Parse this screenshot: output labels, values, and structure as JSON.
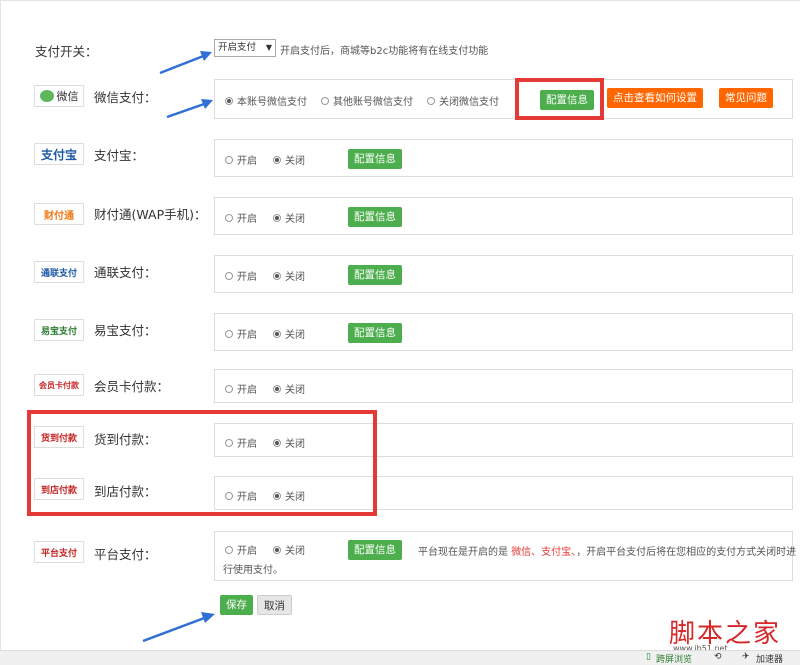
{
  "toggle": {
    "label": "支付开关：",
    "selected": "开启支付",
    "hint": "开启支付后，商城等b2c功能将有在线支付功能"
  },
  "common": {
    "on": "开启",
    "off": "关闭",
    "config": "配置信息"
  },
  "wechat": {
    "label": "微信支付：",
    "logo_text": "微信",
    "opt1": "本账号微信支付",
    "opt2": "其他账号微信支付",
    "opt3": "关闭微信支付",
    "config": "配置信息",
    "howto": "点击查看如何设置",
    "faq": "常见问题"
  },
  "alipay": {
    "label": "支付宝：",
    "logo_text": "支付宝"
  },
  "tenpay": {
    "label": "财付通(WAP手机)：",
    "logo_text": "财付通"
  },
  "unionpay": {
    "label": "通联支付：",
    "logo_text": "通联支付"
  },
  "yeepay": {
    "label": "易宝支付：",
    "logo_text": "易宝支付"
  },
  "member": {
    "label": "会员卡付款：",
    "logo_text": "会员卡付款"
  },
  "cod": {
    "label": "货到付款：",
    "logo_text": "货到付款"
  },
  "store": {
    "label": "到店付款：",
    "logo_text": "到店付款"
  },
  "platform": {
    "label": "平台支付：",
    "logo_text": "平台支付",
    "note_pre": "平台现在是开启的是",
    "note_hl": "微信、支付宝、",
    "note_post": "，开启平台支付后将在您相应的支付方式关闭时进",
    "note_line2": "行使用支付。"
  },
  "actions": {
    "save": "保存",
    "cancel": "取消"
  },
  "watermark": {
    "text": "脚本之家",
    "url": "www.jb51.net"
  },
  "footer": {
    "item1": "跨屏浏览",
    "item2": "加速器"
  },
  "colors": {
    "green": "#4cae4c",
    "orange": "#ff6600",
    "red_frame": "#e53935",
    "arrow": "#2f6fd6"
  }
}
